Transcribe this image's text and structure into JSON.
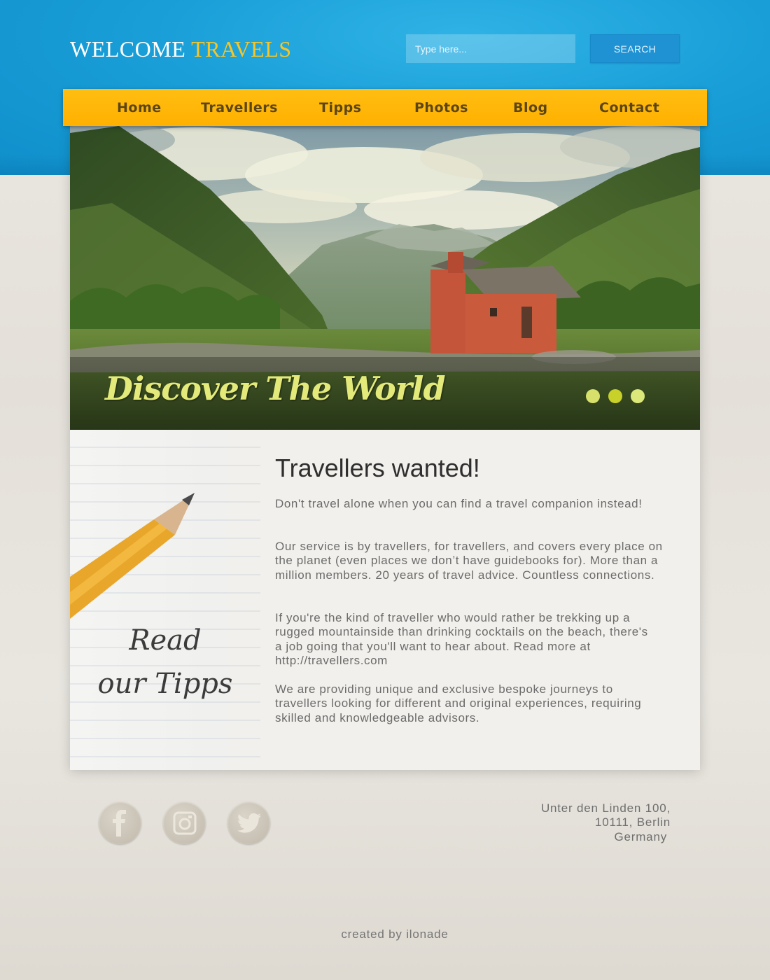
{
  "header": {
    "logo_main": "WELCOME",
    "logo_accent": "TRAVELS",
    "search": {
      "placeholder": "Type here...",
      "value": "",
      "button_label": "SEARCH"
    }
  },
  "nav": {
    "items": [
      {
        "label": "Home"
      },
      {
        "label": "Travellers"
      },
      {
        "label": "Tipps"
      },
      {
        "label": "Photos"
      },
      {
        "label": "Blog"
      },
      {
        "label": "Contact"
      }
    ]
  },
  "hero": {
    "title": "Discover The World",
    "slides": 3,
    "dot_colors": [
      "#d6e06a",
      "#c8d02a",
      "#dde87a"
    ]
  },
  "sidebar": {
    "line1": "Read",
    "line2": "our Tipps"
  },
  "article": {
    "title": "Travellers wanted!",
    "paragraphs": [
      "Don't travel alone when you can find a travel companion instead!",
      "Our service is by travellers, for travellers, and covers every place on the planet (even places we don’t have guidebooks for). More than a million members. 20 years of travel advice. Countless connections.",
      "If you're the kind of traveller who would rather be trekking up a rugged mountainside than drinking cocktails on the beach, there's a job going that you'll want to hear about. Read more at http://travellers.com",
      "We are providing unique and exclusive bespoke journeys to travellers looking for different and original experiences, requiring skilled and knowledgeable advisors."
    ]
  },
  "footer": {
    "social": [
      "facebook-icon",
      "instagram-icon",
      "twitter-icon"
    ],
    "address": [
      "Unter den Linden 100,",
      "10111, Berlin",
      "Germany"
    ],
    "credit": "created by ilonade"
  },
  "colors": {
    "header_blue": "#1a9fd8",
    "nav_yellow": "#ffb000",
    "logo_accent": "#f6c628",
    "hero_title": "#e3ea7a"
  }
}
